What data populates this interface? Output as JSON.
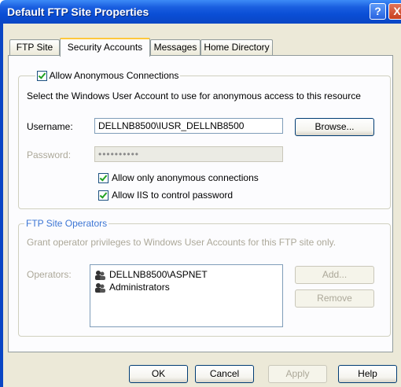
{
  "window": {
    "title": "Default FTP Site Properties",
    "help_button": "?",
    "close_button": "X"
  },
  "tabs": [
    {
      "label": "FTP Site"
    },
    {
      "label": "Security Accounts"
    },
    {
      "label": "Messages"
    },
    {
      "label": "Home Directory"
    }
  ],
  "anonymous": {
    "checkbox_label": "Allow Anonymous Connections",
    "description": "Select the Windows User Account to use for anonymous access to this resource",
    "username_label": "Username:",
    "username_value": "DELLNB8500\\IUSR_DELLNB8500",
    "browse_label": "Browse...",
    "password_label": "Password:",
    "password_value": "••••••••••",
    "allow_only_anonymous_label": "Allow only anonymous connections",
    "allow_iis_label": "Allow IIS to control password"
  },
  "operators": {
    "group_label": "FTP Site Operators",
    "description": "Grant operator privileges to Windows User Accounts for this FTP site only.",
    "operators_label": "Operators:",
    "items": [
      {
        "label": "DELLNB8500\\ASPNET"
      },
      {
        "label": "Administrators"
      }
    ],
    "add_label": "Add...",
    "remove_label": "Remove"
  },
  "footer": {
    "ok_label": "OK",
    "cancel_label": "Cancel",
    "apply_label": "Apply",
    "help_label": "Help"
  }
}
